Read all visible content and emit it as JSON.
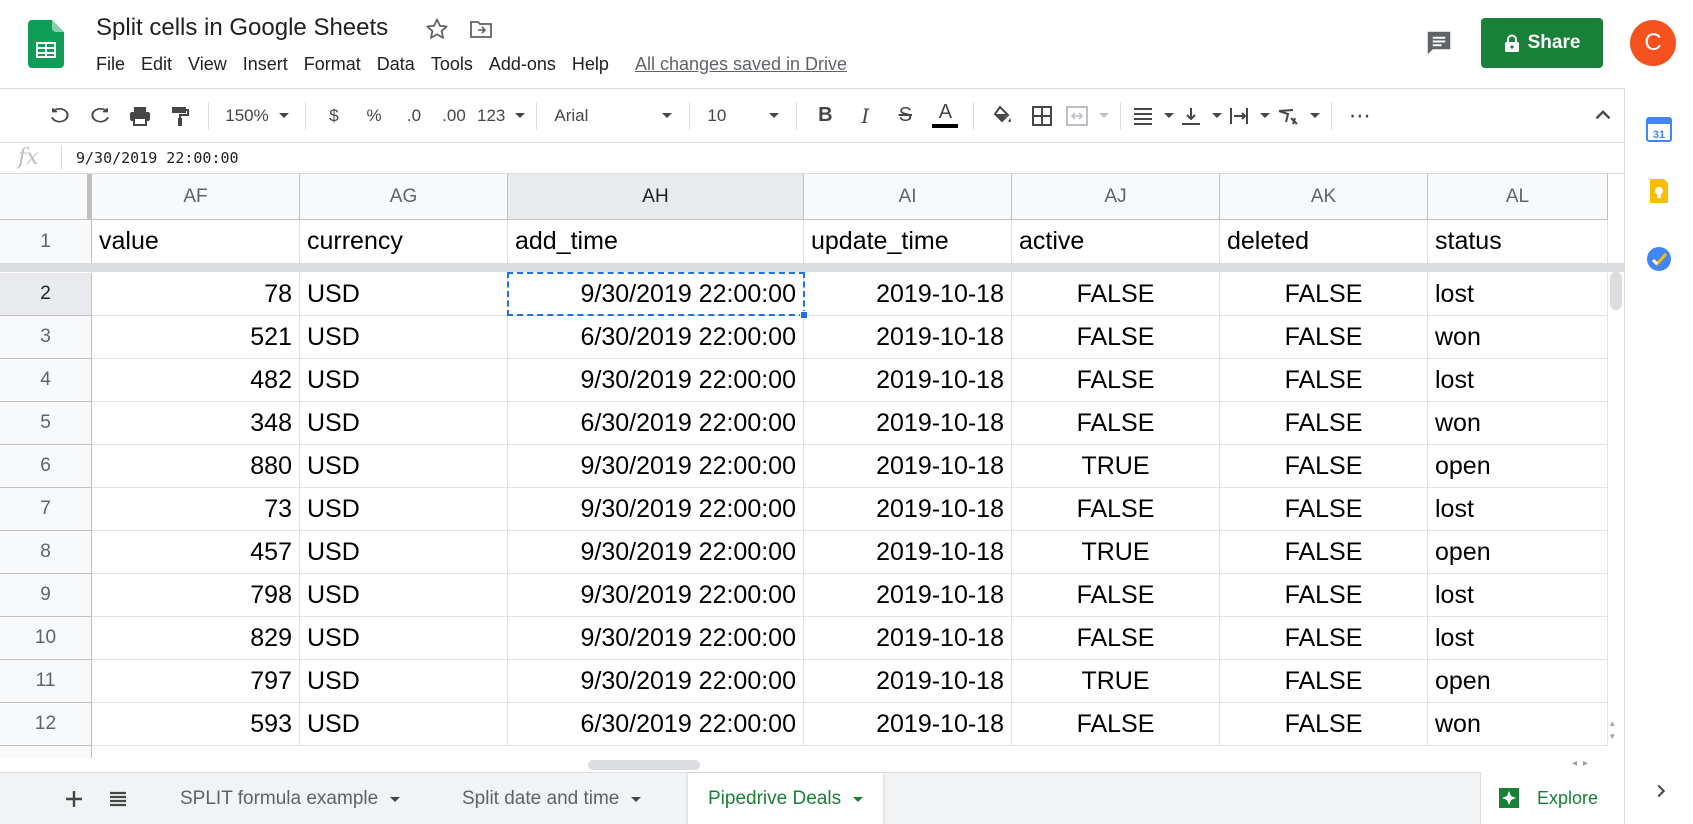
{
  "app": {
    "title": "Split cells in Google Sheets",
    "saved_status": "All changes saved in Drive",
    "share_label": "Share",
    "avatar_initial": "C",
    "accent_color": "#188038",
    "avatar_color": "#f4511e"
  },
  "menu": [
    "File",
    "Edit",
    "View",
    "Insert",
    "Format",
    "Data",
    "Tools",
    "Add-ons",
    "Help"
  ],
  "toolbar": {
    "zoom": "150%",
    "currency": "$",
    "percent": "%",
    "decrease_decimals": ".0",
    "increase_decimals": ".00",
    "more_formats": "123",
    "font": "Arial",
    "font_size": "10",
    "bold": "B",
    "italic": "I",
    "strike": "S",
    "text_color": "A",
    "more": "⋯"
  },
  "formula_bar": {
    "fx": "fx",
    "value": "9/30/2019 22:00:00"
  },
  "columns": [
    {
      "id": "AF",
      "header": "value",
      "align": "r"
    },
    {
      "id": "AG",
      "header": "currency",
      "align": "l"
    },
    {
      "id": "AH",
      "header": "add_time",
      "align": "r"
    },
    {
      "id": "AI",
      "header": "update_time",
      "align": "r"
    },
    {
      "id": "AJ",
      "header": "active",
      "align": "c"
    },
    {
      "id": "AK",
      "header": "deleted",
      "align": "c"
    },
    {
      "id": "AL",
      "header": "status",
      "align": "l"
    }
  ],
  "rows": [
    {
      "n": "2",
      "cells": [
        "78",
        "USD",
        "9/30/2019 22:00:00",
        "2019-10-18",
        "FALSE",
        "FALSE",
        "lost"
      ]
    },
    {
      "n": "3",
      "cells": [
        "521",
        "USD",
        "6/30/2019 22:00:00",
        "2019-10-18",
        "FALSE",
        "FALSE",
        "won"
      ]
    },
    {
      "n": "4",
      "cells": [
        "482",
        "USD",
        "9/30/2019 22:00:00",
        "2019-10-18",
        "FALSE",
        "FALSE",
        "lost"
      ]
    },
    {
      "n": "5",
      "cells": [
        "348",
        "USD",
        "6/30/2019 22:00:00",
        "2019-10-18",
        "FALSE",
        "FALSE",
        "won"
      ]
    },
    {
      "n": "6",
      "cells": [
        "880",
        "USD",
        "9/30/2019 22:00:00",
        "2019-10-18",
        "TRUE",
        "FALSE",
        "open"
      ]
    },
    {
      "n": "7",
      "cells": [
        "73",
        "USD",
        "9/30/2019 22:00:00",
        "2019-10-18",
        "FALSE",
        "FALSE",
        "lost"
      ]
    },
    {
      "n": "8",
      "cells": [
        "457",
        "USD",
        "9/30/2019 22:00:00",
        "2019-10-18",
        "TRUE",
        "FALSE",
        "open"
      ]
    },
    {
      "n": "9",
      "cells": [
        "798",
        "USD",
        "9/30/2019 22:00:00",
        "2019-10-18",
        "FALSE",
        "FALSE",
        "lost"
      ]
    },
    {
      "n": "10",
      "cells": [
        "829",
        "USD",
        "9/30/2019 22:00:00",
        "2019-10-18",
        "FALSE",
        "FALSE",
        "lost"
      ]
    },
    {
      "n": "11",
      "cells": [
        "797",
        "USD",
        "9/30/2019 22:00:00",
        "2019-10-18",
        "TRUE",
        "FALSE",
        "open"
      ]
    },
    {
      "n": "12",
      "cells": [
        "593",
        "USD",
        "6/30/2019 22:00:00",
        "2019-10-18",
        "FALSE",
        "FALSE",
        "won"
      ]
    }
  ],
  "header_row_number": "1",
  "selected": {
    "column": "AH",
    "row": "2"
  },
  "sheets": [
    {
      "label": "SPLIT formula example",
      "active": false
    },
    {
      "label": "Split date and time",
      "active": false
    },
    {
      "label": "Pipedrive Deals",
      "active": true
    }
  ],
  "explore_label": "Explore",
  "side_panel": {
    "calendar_day": "31"
  }
}
